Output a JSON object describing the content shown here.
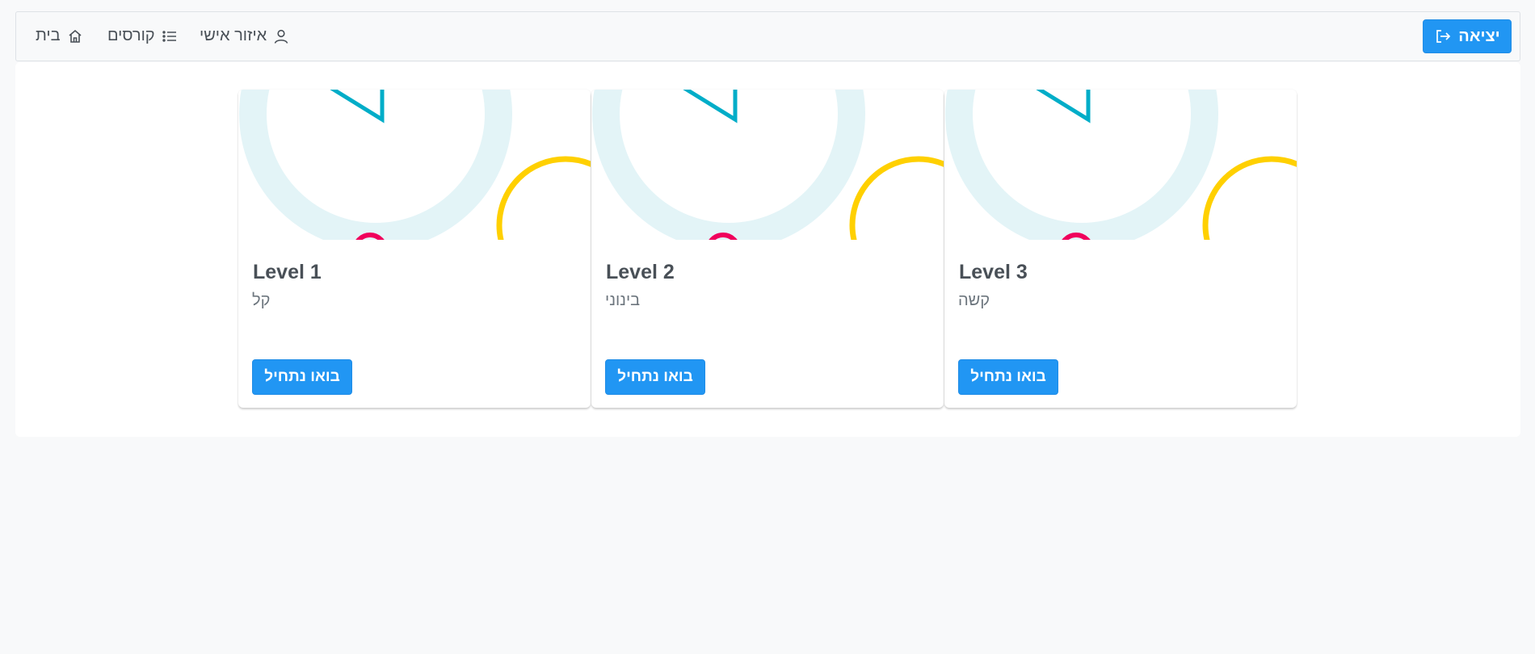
{
  "topbar": {
    "logout_label": "יציאה",
    "nav": [
      {
        "label": "בית",
        "icon": "home-icon"
      },
      {
        "label": "קורסים",
        "icon": "list-icon"
      },
      {
        "label": "איזור אישי",
        "icon": "user-icon"
      }
    ]
  },
  "cards": [
    {
      "title": "Level 1",
      "subtitle": "קל",
      "button_label": "בואו נתחיל"
    },
    {
      "title": "Level 2",
      "subtitle": "בינוני",
      "button_label": "בואו נתחיל"
    },
    {
      "title": "Level 3",
      "subtitle": "קשה",
      "button_label": "בואו נתחיל"
    }
  ],
  "colors": {
    "primary": "#2196f3",
    "ring_light": "#e3f4f7",
    "accent_cyan": "#00adc8",
    "accent_yellow": "#ffd000",
    "accent_pink": "#f0005c"
  }
}
